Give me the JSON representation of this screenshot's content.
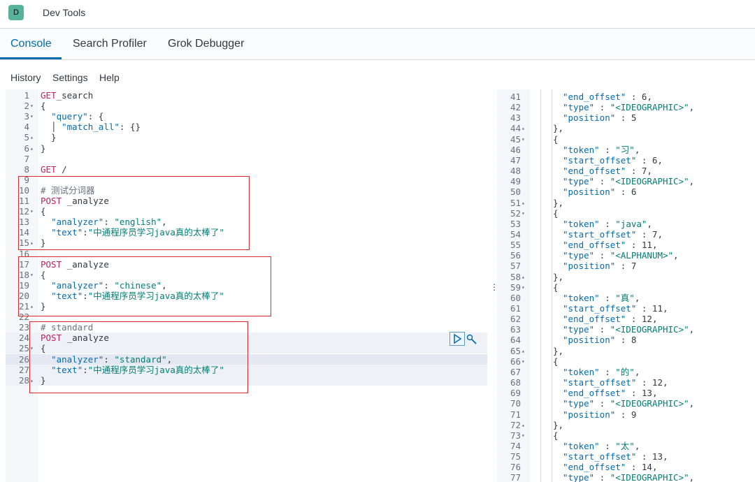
{
  "app": {
    "logo_letter": "D",
    "title": "Dev Tools"
  },
  "tabs": [
    {
      "label": "Console",
      "active": true
    },
    {
      "label": "Search Profiler",
      "active": false
    },
    {
      "label": "Grok Debugger",
      "active": false
    }
  ],
  "menu": {
    "history": "History",
    "settings": "Settings",
    "help": "Help"
  },
  "editor": {
    "lines": [
      {
        "n": "1",
        "fold": "",
        "parts": [
          [
            "kw",
            "GET"
          ],
          [
            "",
            "_search"
          ]
        ]
      },
      {
        "n": "2",
        "fold": "▾",
        "parts": [
          [
            "",
            "{"
          ]
        ]
      },
      {
        "n": "3",
        "fold": "▾",
        "parts": [
          [
            "",
            "  "
          ],
          [
            "key",
            "\"query\""
          ],
          [
            "",
            ": {"
          ]
        ]
      },
      {
        "n": "4",
        "fold": "",
        "parts": [
          [
            "",
            "  │ "
          ],
          [
            "key",
            "\"match_all\""
          ],
          [
            "",
            ": {}"
          ]
        ]
      },
      {
        "n": "5",
        "fold": "▴",
        "parts": [
          [
            "",
            "  }"
          ]
        ]
      },
      {
        "n": "6",
        "fold": "▴",
        "parts": [
          [
            "",
            "}"
          ]
        ]
      },
      {
        "n": "7",
        "fold": "",
        "parts": []
      },
      {
        "n": "8",
        "fold": "",
        "parts": [
          [
            "kw",
            "GET"
          ],
          [
            "",
            " /"
          ]
        ]
      },
      {
        "n": "9",
        "fold": "",
        "parts": []
      },
      {
        "n": "10",
        "fold": "",
        "parts": [
          [
            "cm",
            "# 测试分词器"
          ]
        ]
      },
      {
        "n": "11",
        "fold": "",
        "parts": [
          [
            "kw",
            "POST"
          ],
          [
            "",
            " _analyze"
          ]
        ]
      },
      {
        "n": "12",
        "fold": "▾",
        "parts": [
          [
            "",
            "{"
          ]
        ]
      },
      {
        "n": "13",
        "fold": "",
        "parts": [
          [
            "",
            "  "
          ],
          [
            "key",
            "\"analyzer\""
          ],
          [
            "",
            ": "
          ],
          [
            "str",
            "\"english\""
          ],
          [
            "",
            ","
          ]
        ]
      },
      {
        "n": "14",
        "fold": "",
        "parts": [
          [
            "",
            "  "
          ],
          [
            "key",
            "\"text\""
          ],
          [
            "",
            ":"
          ],
          [
            "str",
            "\"中通程序员学习java真的太棒了\""
          ]
        ]
      },
      {
        "n": "15",
        "fold": "▴",
        "parts": [
          [
            "",
            "}"
          ]
        ]
      },
      {
        "n": "16",
        "fold": "",
        "parts": []
      },
      {
        "n": "17",
        "fold": "",
        "parts": [
          [
            "kw",
            "POST"
          ],
          [
            "",
            " _analyze"
          ]
        ]
      },
      {
        "n": "18",
        "fold": "▾",
        "parts": [
          [
            "",
            "{"
          ]
        ]
      },
      {
        "n": "19",
        "fold": "",
        "parts": [
          [
            "",
            "  "
          ],
          [
            "key",
            "\"analyzer\""
          ],
          [
            "",
            ": "
          ],
          [
            "str",
            "\"chinese\""
          ],
          [
            "",
            ","
          ]
        ]
      },
      {
        "n": "20",
        "fold": "",
        "parts": [
          [
            "",
            "  "
          ],
          [
            "key",
            "\"text\""
          ],
          [
            "",
            ":"
          ],
          [
            "str",
            "\"中通程序员学习java真的太棒了\""
          ]
        ]
      },
      {
        "n": "21",
        "fold": "▴",
        "parts": [
          [
            "",
            "}"
          ]
        ]
      },
      {
        "n": "22",
        "fold": "",
        "parts": []
      },
      {
        "n": "23",
        "fold": "",
        "parts": [
          [
            "cm",
            "# standard"
          ]
        ]
      },
      {
        "n": "24",
        "fold": "",
        "parts": [
          [
            "kw",
            "POST"
          ],
          [
            "",
            " _analyze"
          ]
        ]
      },
      {
        "n": "25",
        "fold": "▾",
        "parts": [
          [
            "",
            "{"
          ]
        ]
      },
      {
        "n": "26",
        "fold": "",
        "parts": [
          [
            "",
            "  "
          ],
          [
            "key",
            "\"analyzer\""
          ],
          [
            "",
            ": "
          ],
          [
            "str",
            "\"standard\""
          ],
          [
            "",
            ","
          ]
        ]
      },
      {
        "n": "27",
        "fold": "",
        "parts": [
          [
            "",
            "  "
          ],
          [
            "key",
            "\"text\""
          ],
          [
            "",
            ":"
          ],
          [
            "str",
            "\"中通程序员学习java真的太棒了\""
          ]
        ]
      },
      {
        "n": "28",
        "fold": "▴",
        "parts": [
          [
            "",
            "}"
          ]
        ]
      }
    ]
  },
  "output": {
    "lines": [
      {
        "n": "41",
        "fold": "",
        "parts": [
          [
            "key",
            "\"end_offset\""
          ],
          [
            "",
            " : 6,"
          ]
        ]
      },
      {
        "n": "42",
        "fold": "",
        "parts": [
          [
            "key",
            "\"type\""
          ],
          [
            "",
            " : "
          ],
          [
            "str",
            "\"<IDEOGRAPHIC>\""
          ],
          [
            "",
            ","
          ]
        ]
      },
      {
        "n": "43",
        "fold": "",
        "parts": [
          [
            "key",
            "\"position\""
          ],
          [
            "",
            " : 5"
          ]
        ]
      },
      {
        "n": "44",
        "fold": "▴",
        "parts": [
          [
            "",
            "},"
          ]
        ],
        "outer": true
      },
      {
        "n": "45",
        "fold": "▾",
        "parts": [
          [
            "",
            "{"
          ]
        ],
        "outer": true
      },
      {
        "n": "46",
        "fold": "",
        "parts": [
          [
            "key",
            "\"token\""
          ],
          [
            "",
            " : "
          ],
          [
            "str",
            "\"习\""
          ],
          [
            "",
            ","
          ]
        ]
      },
      {
        "n": "47",
        "fold": "",
        "parts": [
          [
            "key",
            "\"start_offset\""
          ],
          [
            "",
            " : 6,"
          ]
        ]
      },
      {
        "n": "48",
        "fold": "",
        "parts": [
          [
            "key",
            "\"end_offset\""
          ],
          [
            "",
            " : 7,"
          ]
        ]
      },
      {
        "n": "49",
        "fold": "",
        "parts": [
          [
            "key",
            "\"type\""
          ],
          [
            "",
            " : "
          ],
          [
            "str",
            "\"<IDEOGRAPHIC>\""
          ],
          [
            "",
            ","
          ]
        ]
      },
      {
        "n": "50",
        "fold": "",
        "parts": [
          [
            "key",
            "\"position\""
          ],
          [
            "",
            " : 6"
          ]
        ]
      },
      {
        "n": "51",
        "fold": "▴",
        "parts": [
          [
            "",
            "},"
          ]
        ],
        "outer": true
      },
      {
        "n": "52",
        "fold": "▾",
        "parts": [
          [
            "",
            "{"
          ]
        ],
        "outer": true
      },
      {
        "n": "53",
        "fold": "",
        "parts": [
          [
            "key",
            "\"token\""
          ],
          [
            "",
            " : "
          ],
          [
            "str",
            "\"java\""
          ],
          [
            "",
            ","
          ]
        ]
      },
      {
        "n": "54",
        "fold": "",
        "parts": [
          [
            "key",
            "\"start_offset\""
          ],
          [
            "",
            " : 7,"
          ]
        ]
      },
      {
        "n": "55",
        "fold": "",
        "parts": [
          [
            "key",
            "\"end_offset\""
          ],
          [
            "",
            " : 11,"
          ]
        ]
      },
      {
        "n": "56",
        "fold": "",
        "parts": [
          [
            "key",
            "\"type\""
          ],
          [
            "",
            " : "
          ],
          [
            "str",
            "\"<ALPHANUM>\""
          ],
          [
            "",
            ","
          ]
        ]
      },
      {
        "n": "57",
        "fold": "",
        "parts": [
          [
            "key",
            "\"position\""
          ],
          [
            "",
            " : 7"
          ]
        ]
      },
      {
        "n": "58",
        "fold": "▴",
        "parts": [
          [
            "",
            "},"
          ]
        ],
        "outer": true
      },
      {
        "n": "59",
        "fold": "▾",
        "parts": [
          [
            "",
            "{"
          ]
        ],
        "outer": true
      },
      {
        "n": "60",
        "fold": "",
        "parts": [
          [
            "key",
            "\"token\""
          ],
          [
            "",
            " : "
          ],
          [
            "str",
            "\"真\""
          ],
          [
            "",
            ","
          ]
        ]
      },
      {
        "n": "61",
        "fold": "",
        "parts": [
          [
            "key",
            "\"start_offset\""
          ],
          [
            "",
            " : 11,"
          ]
        ]
      },
      {
        "n": "62",
        "fold": "",
        "parts": [
          [
            "key",
            "\"end_offset\""
          ],
          [
            "",
            " : 12,"
          ]
        ]
      },
      {
        "n": "63",
        "fold": "",
        "parts": [
          [
            "key",
            "\"type\""
          ],
          [
            "",
            " : "
          ],
          [
            "str",
            "\"<IDEOGRAPHIC>\""
          ],
          [
            "",
            ","
          ]
        ]
      },
      {
        "n": "64",
        "fold": "",
        "parts": [
          [
            "key",
            "\"position\""
          ],
          [
            "",
            " : 8"
          ]
        ]
      },
      {
        "n": "65",
        "fold": "▴",
        "parts": [
          [
            "",
            "},"
          ]
        ],
        "outer": true
      },
      {
        "n": "66",
        "fold": "▾",
        "parts": [
          [
            "",
            "{"
          ]
        ],
        "outer": true
      },
      {
        "n": "67",
        "fold": "",
        "parts": [
          [
            "key",
            "\"token\""
          ],
          [
            "",
            " : "
          ],
          [
            "str",
            "\"的\""
          ],
          [
            "",
            ","
          ]
        ]
      },
      {
        "n": "68",
        "fold": "",
        "parts": [
          [
            "key",
            "\"start_offset\""
          ],
          [
            "",
            " : 12,"
          ]
        ]
      },
      {
        "n": "69",
        "fold": "",
        "parts": [
          [
            "key",
            "\"end_offset\""
          ],
          [
            "",
            " : 13,"
          ]
        ]
      },
      {
        "n": "70",
        "fold": "",
        "parts": [
          [
            "key",
            "\"type\""
          ],
          [
            "",
            " : "
          ],
          [
            "str",
            "\"<IDEOGRAPHIC>\""
          ],
          [
            "",
            ","
          ]
        ]
      },
      {
        "n": "71",
        "fold": "",
        "parts": [
          [
            "key",
            "\"position\""
          ],
          [
            "",
            " : 9"
          ]
        ]
      },
      {
        "n": "72",
        "fold": "▴",
        "parts": [
          [
            "",
            "},"
          ]
        ],
        "outer": true
      },
      {
        "n": "73",
        "fold": "▾",
        "parts": [
          [
            "",
            "{"
          ]
        ],
        "outer": true
      },
      {
        "n": "74",
        "fold": "",
        "parts": [
          [
            "key",
            "\"token\""
          ],
          [
            "",
            " : "
          ],
          [
            "str",
            "\"太\""
          ],
          [
            "",
            ","
          ]
        ]
      },
      {
        "n": "75",
        "fold": "",
        "parts": [
          [
            "key",
            "\"start_offset\""
          ],
          [
            "",
            " : 13,"
          ]
        ]
      },
      {
        "n": "76",
        "fold": "",
        "parts": [
          [
            "key",
            "\"end_offset\""
          ],
          [
            "",
            " : 14,"
          ]
        ]
      },
      {
        "n": "77",
        "fold": "",
        "parts": [
          [
            "key",
            "\"type\""
          ],
          [
            "",
            " : "
          ],
          [
            "str",
            "\"<IDEOGRAPHIC>\""
          ],
          [
            "",
            ","
          ]
        ]
      }
    ]
  },
  "colors": {
    "accent": "#006bb4",
    "keyword": "#c61e5a",
    "string": "#017d73",
    "annotation_box": "#e0282b",
    "logo": "#54b399"
  }
}
